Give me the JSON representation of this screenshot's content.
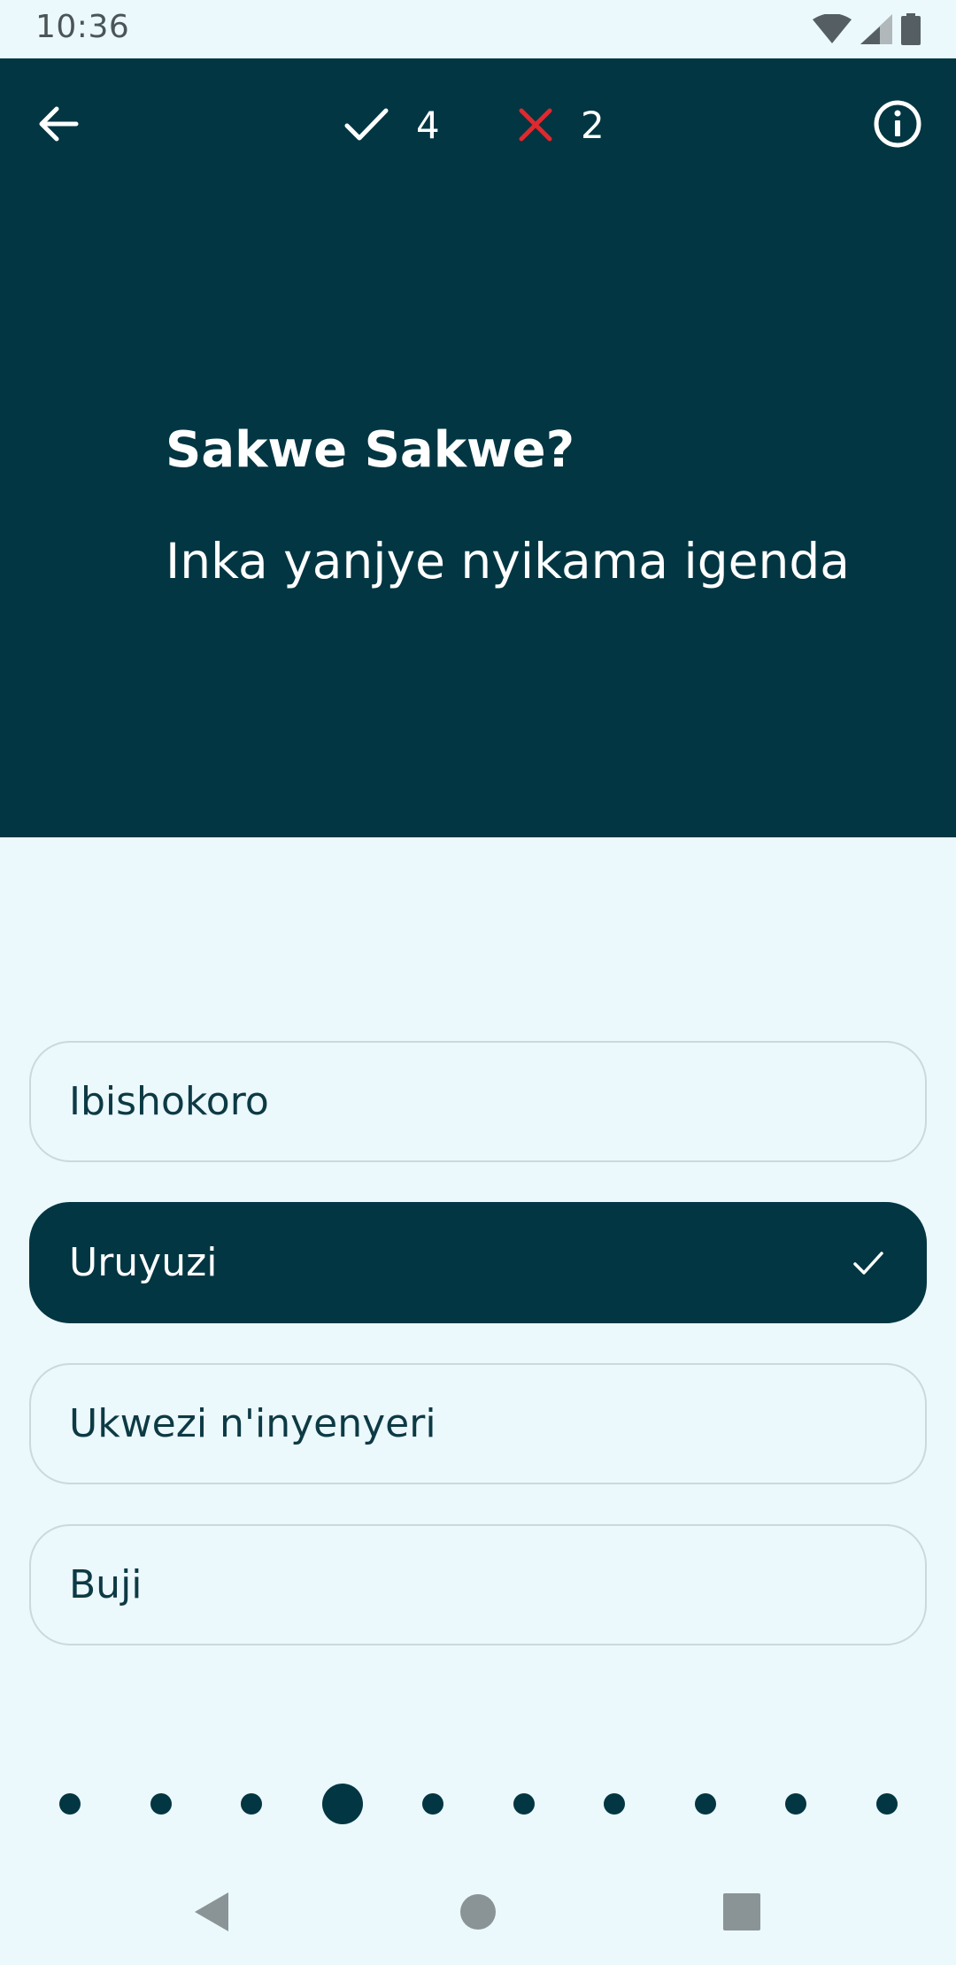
{
  "status_bar": {
    "time": "10:36"
  },
  "header": {
    "back_icon": "arrow-left-icon",
    "info_icon": "info-icon",
    "score": {
      "correct_count": "4",
      "wrong_count": "2"
    },
    "colors": {
      "background": "#023642",
      "correct": "#FFFFFF",
      "wrong": "#E0282E"
    }
  },
  "question": {
    "title": "Sakwe Sakwe?",
    "text": "Inka yanjye nyikama igenda"
  },
  "options": [
    {
      "label": "Ibishokoro",
      "selected": false
    },
    {
      "label": "Uruyuzi",
      "selected": true
    },
    {
      "label": "Ukwezi n'inyenyeri",
      "selected": false
    },
    {
      "label": "Buji",
      "selected": false
    }
  ],
  "progress": {
    "total": 10,
    "current": 4
  },
  "navbar": {
    "back_icon": "nav-back-icon",
    "home_icon": "nav-home-icon",
    "recents_icon": "nav-recents-icon"
  }
}
